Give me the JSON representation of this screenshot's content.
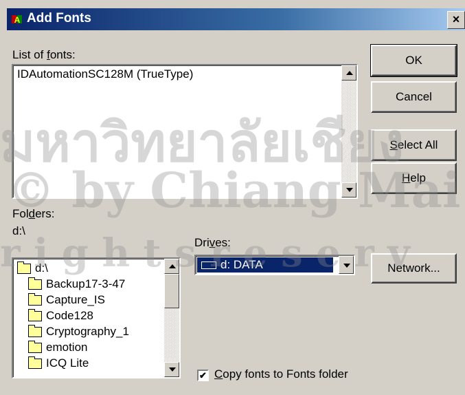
{
  "window": {
    "title": "Add Fonts",
    "close_glyph": "×"
  },
  "fonts_list": {
    "label_pre": "List of ",
    "label_u": "f",
    "label_post": "onts:",
    "items": [
      "IDAutomationSC128M (TrueType)"
    ]
  },
  "buttons": {
    "ok": "OK",
    "cancel": "Cancel",
    "select_all_u": "S",
    "select_all_rest": "elect All",
    "help_u": "H",
    "help_rest": "elp",
    "network": "Network..."
  },
  "folders": {
    "label_pre": "Fol",
    "label_u": "d",
    "label_post": "ers:",
    "current_path": "d:\\",
    "items": [
      "d:\\",
      "Backup17-3-47",
      "Capture_IS",
      "Code128",
      "Cryptography_1",
      "emotion",
      "ICQ Lite"
    ]
  },
  "drives": {
    "label_pre": "Dri",
    "label_u": "v",
    "label_post": "es:",
    "selected": "d: DATA"
  },
  "copy_option": {
    "checked_glyph": "✔",
    "label_u": "C",
    "label_rest": "opy fonts to Fonts folder"
  },
  "watermark": {
    "line1": "มหาวิทยาลัยเชียง",
    "line2": "© by Chiang Mai Uni",
    "line3": "r i g h t s  r e s e r v"
  }
}
